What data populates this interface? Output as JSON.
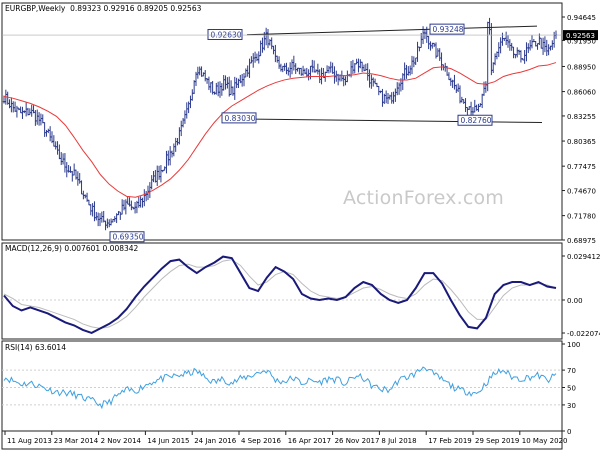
{
  "symbol_label": "EURGBP,Weekly",
  "ohlc_label": "0.89323 0.92916 0.89205 0.92563",
  "watermark": "ActionForex.com",
  "macd_label": "MACD(12,26,9) 0.007601 0.008342",
  "rsi_label": "RSI(14) 63.6014",
  "colors": {
    "bars": "#2b3a8c",
    "ma": "#e83a3a",
    "line": "#222222",
    "macd": "#1a1a7a",
    "signal": "#bbbbbb",
    "rsi": "#3fa0e0",
    "grid": "#cfcfcf",
    "box": "#2b3a8c"
  },
  "chart_data": [
    {
      "type": "bar",
      "subtype": "ohlc",
      "title": "EURGBP,Weekly",
      "price_ticks": [
        "0.94645",
        "0.91950",
        "0.88950",
        "0.86060",
        "0.83255",
        "0.80365",
        "0.77475",
        "0.74670",
        "0.71780",
        "0.68975"
      ],
      "ylim": [
        0.68975,
        0.94645
      ],
      "current_price": "0.92563",
      "annotations": [
        {
          "text": "0.92630",
          "value": 0.9263
        },
        {
          "text": "0.93248",
          "value": 0.93248
        },
        {
          "text": "0.83030",
          "value": 0.8303
        },
        {
          "text": "0.82760",
          "value": 0.8276
        },
        {
          "text": "0.69350",
          "value": 0.6935
        }
      ],
      "trendlines": [
        {
          "name": "upper",
          "from": 0.926,
          "to": 0.936
        },
        {
          "name": "lower",
          "from": 0.829,
          "to": 0.825
        }
      ],
      "close_path": [
        0.855,
        0.842,
        0.835,
        0.838,
        0.828,
        0.812,
        0.79,
        0.775,
        0.765,
        0.745,
        0.725,
        0.712,
        0.71,
        0.72,
        0.73,
        0.725,
        0.74,
        0.758,
        0.772,
        0.79,
        0.81,
        0.84,
        0.89,
        0.875,
        0.86,
        0.87,
        0.86,
        0.875,
        0.89,
        0.905,
        0.925,
        0.895,
        0.885,
        0.89,
        0.882,
        0.884,
        0.878,
        0.885,
        0.88,
        0.872,
        0.895,
        0.89,
        0.87,
        0.855,
        0.85,
        0.872,
        0.885,
        0.9,
        0.93,
        0.91,
        0.895,
        0.875,
        0.855,
        0.845,
        0.836,
        0.865,
        0.9,
        0.922,
        0.905,
        0.9,
        0.91,
        0.92,
        0.905,
        0.925
      ],
      "ma_path": [
        0.855,
        0.853,
        0.85,
        0.847,
        0.843,
        0.838,
        0.832,
        0.822,
        0.808,
        0.793,
        0.78,
        0.765,
        0.754,
        0.746,
        0.74,
        0.739,
        0.742,
        0.747,
        0.753,
        0.76,
        0.77,
        0.782,
        0.797,
        0.812,
        0.825,
        0.836,
        0.844,
        0.85,
        0.856,
        0.862,
        0.867,
        0.871,
        0.874,
        0.876,
        0.877,
        0.878,
        0.878,
        0.878,
        0.879,
        0.879,
        0.88,
        0.882,
        0.881,
        0.879,
        0.876,
        0.874,
        0.874,
        0.876,
        0.882,
        0.888,
        0.889,
        0.887,
        0.882,
        0.876,
        0.87,
        0.869,
        0.872,
        0.878,
        0.881,
        0.883,
        0.886,
        0.89,
        0.891,
        0.894
      ]
    },
    {
      "type": "line",
      "title": "MACD(12,26,9)",
      "series": [
        {
          "name": "MACD",
          "values": [
            0.003,
            -0.004,
            -0.007,
            -0.005,
            -0.007,
            -0.009,
            -0.012,
            -0.015,
            -0.017,
            -0.02,
            -0.022,
            -0.019,
            -0.016,
            -0.012,
            -0.006,
            0.002,
            0.009,
            0.015,
            0.021,
            0.026,
            0.027,
            0.022,
            0.018,
            0.022,
            0.025,
            0.029,
            0.028,
            0.018,
            0.008,
            0.006,
            0.015,
            0.022,
            0.019,
            0.014,
            0.004,
            0.001,
            0.0,
            0.001,
            0.0,
            0.002,
            0.008,
            0.012,
            0.01,
            0.004,
            0.0,
            -0.002,
            0.0,
            0.008,
            0.018,
            0.018,
            0.011,
            0.0,
            -0.01,
            -0.018,
            -0.019,
            -0.012,
            0.004,
            0.01,
            0.012,
            0.012,
            0.01,
            0.012,
            0.009,
            0.008
          ]
        },
        {
          "name": "Signal",
          "values": [
            0.004,
            0.001,
            -0.003,
            -0.004,
            -0.005,
            -0.007,
            -0.009,
            -0.011,
            -0.013,
            -0.016,
            -0.018,
            -0.019,
            -0.018,
            -0.015,
            -0.011,
            -0.005,
            0.002,
            0.008,
            0.014,
            0.019,
            0.023,
            0.024,
            0.022,
            0.022,
            0.023,
            0.026,
            0.027,
            0.023,
            0.016,
            0.01,
            0.012,
            0.017,
            0.019,
            0.017,
            0.011,
            0.006,
            0.003,
            0.002,
            0.001,
            0.002,
            0.005,
            0.008,
            0.009,
            0.007,
            0.004,
            0.002,
            0.001,
            0.004,
            0.01,
            0.014,
            0.013,
            0.007,
            0.0,
            -0.008,
            -0.013,
            -0.013,
            -0.005,
            0.003,
            0.008,
            0.01,
            0.01,
            0.011,
            0.01,
            0.008
          ]
        }
      ],
      "ticks": [
        "0.029412",
        "0.00",
        "-0.022074"
      ],
      "ylim": [
        -0.022074,
        0.029412
      ]
    },
    {
      "type": "line",
      "title": "RSI(14)",
      "series": [
        {
          "name": "RSI",
          "values": [
            62,
            58,
            54,
            55,
            52,
            48,
            45,
            44,
            42,
            38,
            35,
            30,
            33,
            41,
            47,
            46,
            52,
            57,
            60,
            62,
            64,
            66,
            69,
            61,
            56,
            60,
            55,
            60,
            63,
            67,
            70,
            58,
            57,
            61,
            55,
            58,
            56,
            60,
            59,
            54,
            63,
            61,
            52,
            48,
            47,
            58,
            62,
            66,
            75,
            65,
            59,
            52,
            47,
            45,
            43,
            55,
            66,
            70,
            62,
            60,
            62,
            64,
            58,
            64
          ]
        }
      ],
      "ticks": [
        "100",
        "70",
        "50",
        "30",
        "0"
      ],
      "ylim": [
        0,
        100
      ]
    }
  ],
  "date_ticks": [
    "11 Aug 2013",
    "23 Mar 2014",
    "2 Nov 2014",
    "14 Jun 2015",
    "24 Jan 2016",
    "4 Sep 2016",
    "16 Apr 2017",
    "26 Nov 2017",
    "8 Jul 2018",
    "17 Feb 2019",
    "29 Sep 2019",
    "10 May 2020"
  ]
}
